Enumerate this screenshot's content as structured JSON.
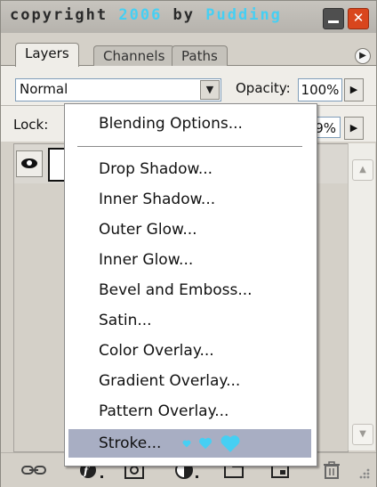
{
  "title": {
    "prefix": "copyright ",
    "year": "2006",
    "middle": " by ",
    "author": "Pudding",
    "accent_color": "#46cff3"
  },
  "tabs": [
    {
      "label": "Layers",
      "active": true
    },
    {
      "label": "Channels",
      "active": false
    },
    {
      "label": "Paths",
      "active": false
    }
  ],
  "blend": {
    "value": "Normal"
  },
  "opacity": {
    "label": "Opacity:",
    "value": "100%"
  },
  "lock": {
    "label": "Lock:"
  },
  "fill": {
    "value": "9%"
  },
  "menu": {
    "header": "Blending Options...",
    "items": [
      "Drop Shadow...",
      "Inner Shadow...",
      "Outer Glow...",
      "Inner Glow...",
      "Bevel and Emboss...",
      "Satin...",
      "Color Overlay...",
      "Gradient Overlay...",
      "Pattern Overlay...",
      "Stroke..."
    ],
    "selected_item": "Stroke...",
    "selected_color": "#a8aec3"
  },
  "icons": {
    "panel_menu": "arrow-circle-icon",
    "eye": "eye-icon",
    "link": "link-icon",
    "fx": "layer-style-icon",
    "mask": "mask-icon",
    "adjust": "adjustment-layer-icon",
    "group": "folder-icon",
    "new": "new-layer-icon",
    "trash": "trash-icon"
  }
}
